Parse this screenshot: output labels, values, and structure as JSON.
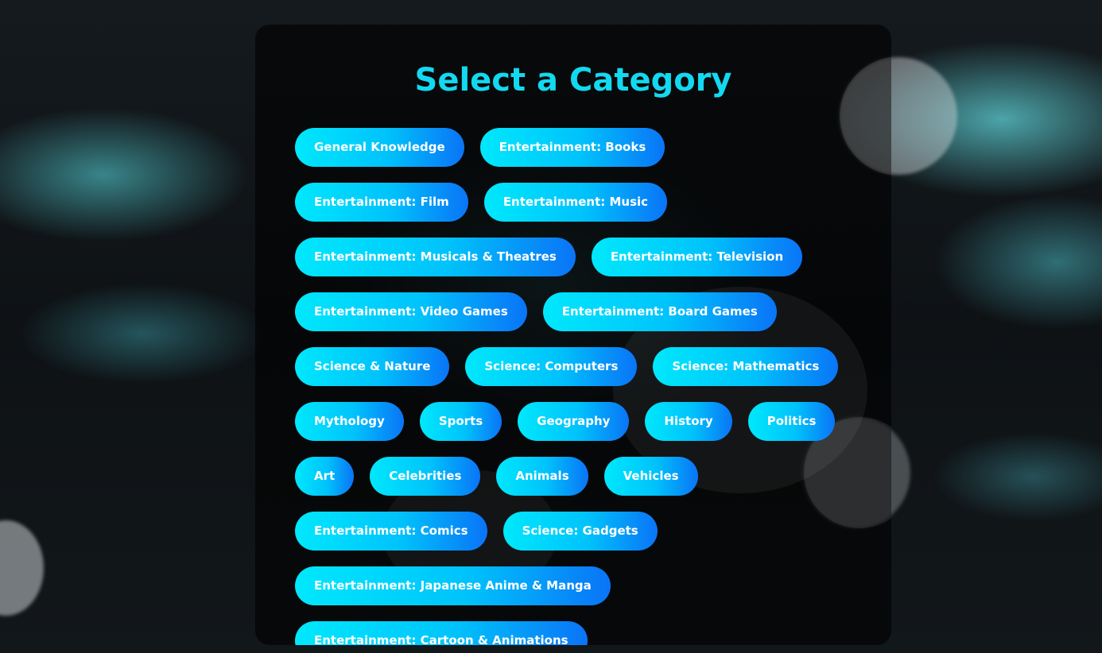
{
  "page": {
    "title": "Select a Category"
  },
  "colors": {
    "title": "#12d9f0",
    "chip_gradient_start": "#00e8fc",
    "chip_gradient_end": "#0a74f7",
    "chip_text": "#ffffff",
    "card_background": "rgba(0,0,0,0.62)"
  },
  "categories": [
    "General Knowledge",
    "Entertainment: Books",
    "Entertainment: Film",
    "Entertainment: Music",
    "Entertainment: Musicals & Theatres",
    "Entertainment: Television",
    "Entertainment: Video Games",
    "Entertainment: Board Games",
    "Science & Nature",
    "Science: Computers",
    "Science: Mathematics",
    "Mythology",
    "Sports",
    "Geography",
    "History",
    "Politics",
    "Art",
    "Celebrities",
    "Animals",
    "Vehicles",
    "Entertainment: Comics",
    "Science: Gadgets",
    "Entertainment: Japanese Anime & Manga",
    "Entertainment: Cartoon & Animations"
  ]
}
